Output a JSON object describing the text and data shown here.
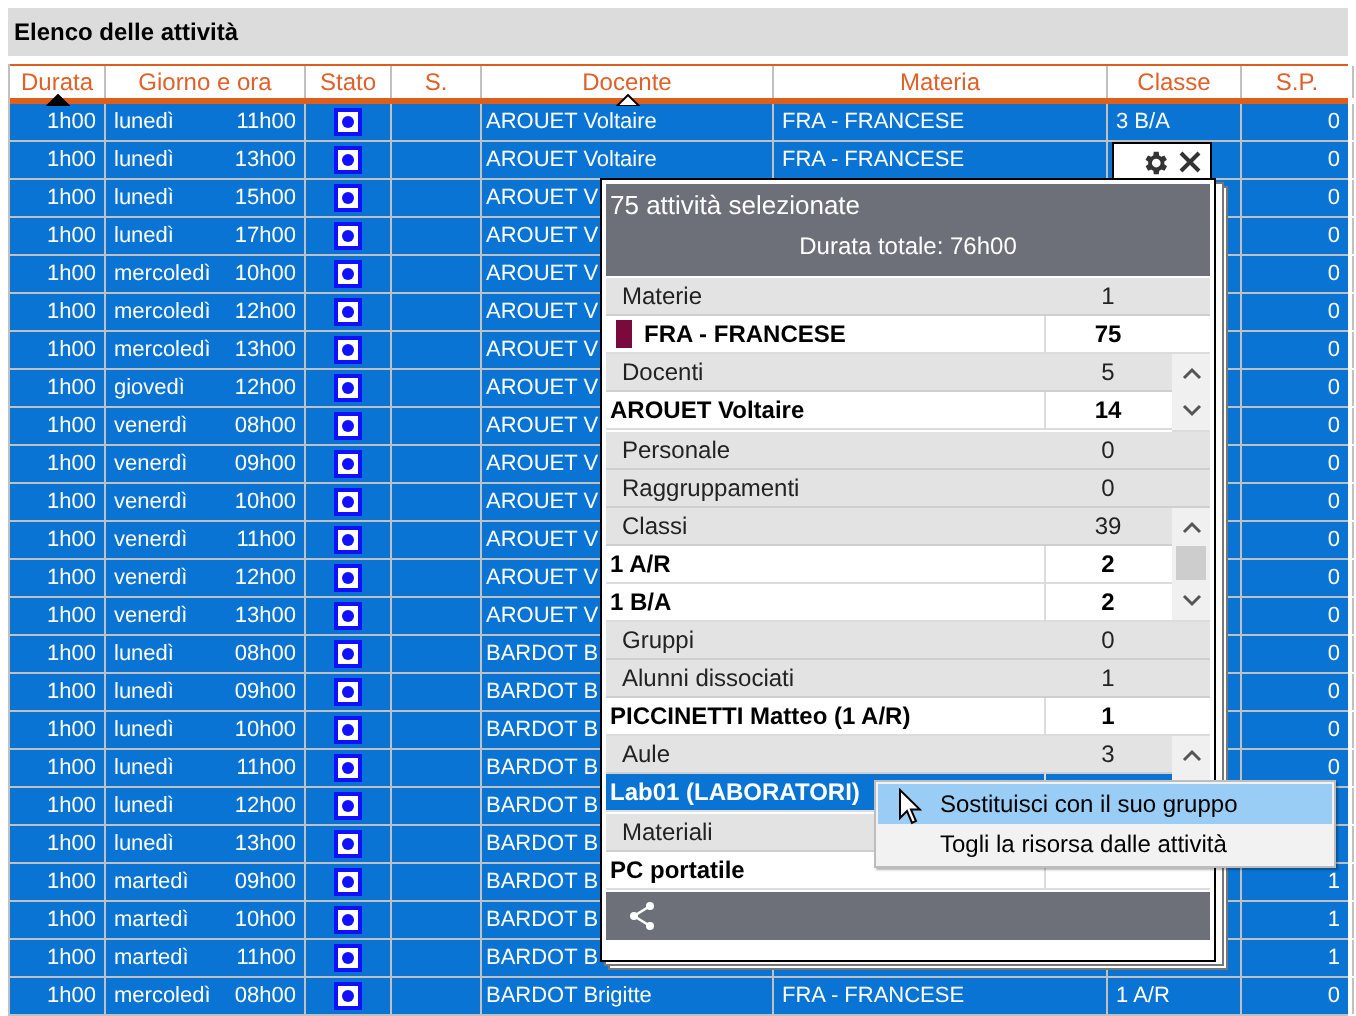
{
  "panel_title": "Elenco delle attività",
  "table": {
    "columns": [
      {
        "label": "Durata",
        "sorted": true,
        "primary": true
      },
      {
        "label": "Giorno e ora",
        "sorted": false
      },
      {
        "label": "Stato",
        "sorted": false
      },
      {
        "label": "S.",
        "sorted": false
      },
      {
        "label": "Docente",
        "sorted": true,
        "primary": false
      },
      {
        "label": "Materia",
        "sorted": false
      },
      {
        "label": "Classe",
        "sorted": false
      },
      {
        "label": "S.P.",
        "sorted": false
      }
    ],
    "rows": [
      {
        "durata": "1h00",
        "giorno": "lunedì",
        "ora": "11h00",
        "docente": "AROUET Voltaire",
        "materia": "FRA - FRANCESE",
        "classe": "3 B/A",
        "sp": "0",
        "selected": true
      },
      {
        "durata": "1h00",
        "giorno": "lunedì",
        "ora": "13h00",
        "docente": "AROUET Voltaire",
        "materia": "FRA - FRANCESE",
        "sp": "0",
        "selected": true
      },
      {
        "durata": "1h00",
        "giorno": "lunedì",
        "ora": "15h00",
        "docente": "AROUET V",
        "sp": "0",
        "selected": true
      },
      {
        "durata": "1h00",
        "giorno": "lunedì",
        "ora": "17h00",
        "docente": "AROUET V",
        "sp": "0",
        "selected": true
      },
      {
        "durata": "1h00",
        "giorno": "mercoledì",
        "ora": "10h00",
        "docente": "AROUET V",
        "sp": "0",
        "selected": true
      },
      {
        "durata": "1h00",
        "giorno": "mercoledì",
        "ora": "12h00",
        "docente": "AROUET V",
        "sp": "0",
        "selected": true
      },
      {
        "durata": "1h00",
        "giorno": "mercoledì",
        "ora": "13h00",
        "docente": "AROUET V",
        "sp": "0",
        "selected": true
      },
      {
        "durata": "1h00",
        "giorno": "giovedì",
        "ora": "12h00",
        "docente": "AROUET V",
        "sp": "0",
        "selected": true
      },
      {
        "durata": "1h00",
        "giorno": "venerdì",
        "ora": "08h00",
        "docente": "AROUET V",
        "sp": "0",
        "selected": true
      },
      {
        "durata": "1h00",
        "giorno": "venerdì",
        "ora": "09h00",
        "docente": "AROUET V",
        "sp": "0",
        "selected": true
      },
      {
        "durata": "1h00",
        "giorno": "venerdì",
        "ora": "10h00",
        "docente": "AROUET V",
        "sp": "0",
        "selected": true
      },
      {
        "durata": "1h00",
        "giorno": "venerdì",
        "ora": "11h00",
        "docente": "AROUET V",
        "sp": "0",
        "selected": true
      },
      {
        "durata": "1h00",
        "giorno": "venerdì",
        "ora": "12h00",
        "docente": "AROUET V",
        "sp": "0",
        "selected": true
      },
      {
        "durata": "1h00",
        "giorno": "venerdì",
        "ora": "13h00",
        "docente": "AROUET V",
        "sp": "0",
        "selected": true
      },
      {
        "durata": "1h00",
        "giorno": "lunedì",
        "ora": "08h00",
        "docente": "BARDOT B",
        "sp": "0",
        "selected": true
      },
      {
        "durata": "1h00",
        "giorno": "lunedì",
        "ora": "09h00",
        "docente": "BARDOT B",
        "sp": "0",
        "selected": true
      },
      {
        "durata": "1h00",
        "giorno": "lunedì",
        "ora": "10h00",
        "docente": "BARDOT B",
        "sp": "0",
        "selected": true
      },
      {
        "durata": "1h00",
        "giorno": "lunedì",
        "ora": "11h00",
        "docente": "BARDOT B",
        "sp": "0",
        "selected": true
      },
      {
        "durata": "1h00",
        "giorno": "lunedì",
        "ora": "12h00",
        "docente": "BARDOT B",
        "selected": true
      },
      {
        "durata": "1h00",
        "giorno": "lunedì",
        "ora": "13h00",
        "docente": "BARDOT B",
        "selected": true
      },
      {
        "durata": "1h00",
        "giorno": "martedì",
        "ora": "09h00",
        "docente": "BARDOT B",
        "sp": "1",
        "selected": true
      },
      {
        "durata": "1h00",
        "giorno": "martedì",
        "ora": "10h00",
        "docente": "BARDOT B",
        "sp": "1",
        "selected": true
      },
      {
        "durata": "1h00",
        "giorno": "martedì",
        "ora": "11h00",
        "docente": "BARDOT B",
        "sp": "1",
        "selected": true
      },
      {
        "durata": "1h00",
        "giorno": "mercoledì",
        "ora": "08h00",
        "docente": "BARDOT Brigitte",
        "materia": "FRA - FRANCESE",
        "classe": "1 A/R",
        "sp": "0",
        "selected": true
      }
    ]
  },
  "popup": {
    "title": "75 attività selezionate",
    "subtitle": "Durata totale: 76h00",
    "sections": [
      {
        "label": "Materie",
        "count": "1",
        "scroll_arrows": false,
        "items": [
          {
            "name": "FRA - FRANCESE",
            "count": "75",
            "color": "#7a0a3c",
            "selected": false
          }
        ]
      },
      {
        "label": "Docenti",
        "count": "5",
        "scroll_arrows": true,
        "scroll_thumb": false,
        "items": [
          {
            "name": "AROUET Voltaire",
            "count": "14",
            "selected": false
          }
        ]
      },
      {
        "label": "Personale",
        "count": "0",
        "scroll_arrows": false
      },
      {
        "label": "Raggruppamenti",
        "count": "0",
        "scroll_arrows": false
      },
      {
        "label": "Classi",
        "count": "39",
        "scroll_arrows": true,
        "scroll_thumb": true,
        "items": [
          {
            "name": "1 A/R",
            "count": "2",
            "selected": false
          },
          {
            "name": "1 B/A",
            "count": "2",
            "selected": false
          }
        ]
      },
      {
        "label": "Gruppi",
        "count": "0",
        "scroll_arrows": false
      },
      {
        "label": "Alunni dissociati",
        "count": "1",
        "scroll_arrows": false,
        "items": [
          {
            "name": "PICCINETTI Matteo (1 A/R)",
            "count": "1",
            "selected": false
          }
        ]
      },
      {
        "label": "Aule",
        "count": "3",
        "scroll_arrows": true,
        "scroll_thumb": false,
        "items": [
          {
            "name": "Lab01 (LABORATORI)",
            "selected": true
          }
        ]
      },
      {
        "label": "Materiali",
        "scroll_arrows": false,
        "items": [
          {
            "name": "PC portatile",
            "selected": false
          }
        ]
      }
    ]
  },
  "context_menu": {
    "items": [
      {
        "label": "Sostituisci con il suo gruppo",
        "selected": true
      },
      {
        "label": "Togli la risorsa dalle attività",
        "selected": false
      }
    ]
  }
}
